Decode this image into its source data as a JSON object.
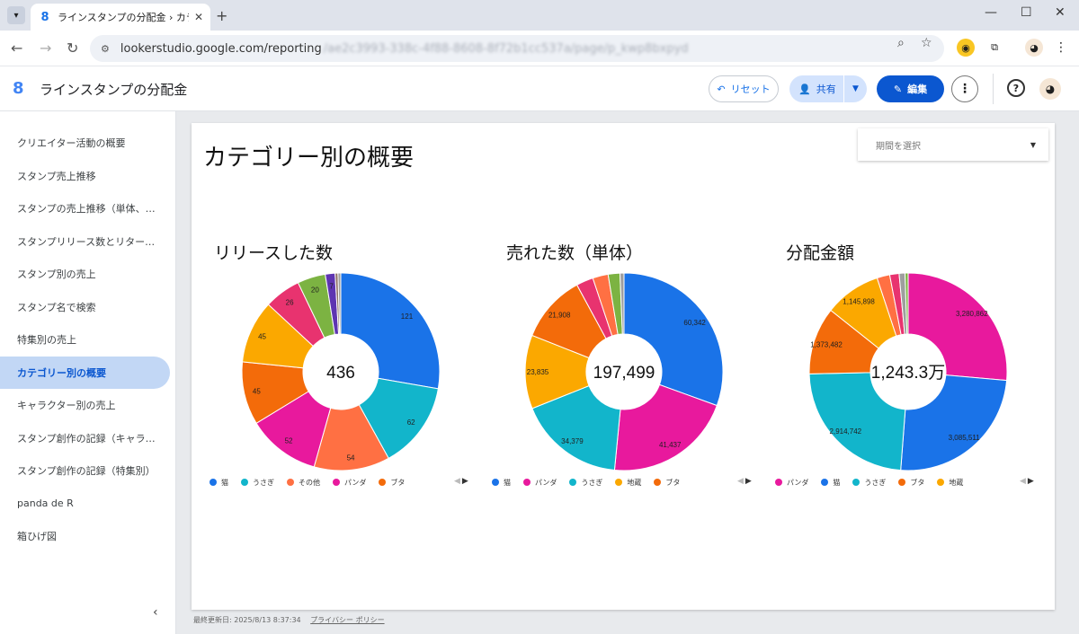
{
  "browser": {
    "tab_title": "ラインスタンプの分配金 › カテゴリー別",
    "url": "lookerstudio.google.com/reporting",
    "url_hidden": "/ae2c3993-338c-4f88-8608-8f72b1cc537a/page/p_kwp8bxpyd"
  },
  "app": {
    "title": "ラインスタンプの分配金",
    "reset_label": "リセット",
    "share_label": "共有",
    "edit_label": "編集"
  },
  "sidebar": {
    "items": [
      {
        "label": "クリエイター活動の概要"
      },
      {
        "label": "スタンプ売上推移"
      },
      {
        "label": "スタンプの売上推移（単体、…"
      },
      {
        "label": "スタンプリリース数とリター…"
      },
      {
        "label": "スタンプ別の売上"
      },
      {
        "label": "スタンプ名で検索"
      },
      {
        "label": "特集別の売上"
      },
      {
        "label": "カテゴリー別の概要",
        "active": true
      },
      {
        "label": "キャラクター別の売上"
      },
      {
        "label": "スタンプ創作の記録（キャラ…"
      },
      {
        "label": "スタンプ創作の記録（特集別）"
      },
      {
        "label": "panda de R"
      },
      {
        "label": "箱ひげ図"
      }
    ]
  },
  "page": {
    "title": "カテゴリー別の概要",
    "date_placeholder": "期間を選択",
    "footer_updated": "最終更新日: 2025/8/13 8:37:34",
    "footer_privacy": "プライバシー ポリシー"
  },
  "chart_data": [
    {
      "type": "pie",
      "title": "リリースした数",
      "center_label": "436",
      "slices": [
        {
          "label": "猫",
          "value": 121,
          "color": "#1a73e8",
          "show": true
        },
        {
          "label": "うさぎ",
          "value": 62,
          "color": "#12b5cb",
          "show": true
        },
        {
          "label": "その他",
          "value": 54,
          "color": "#ff7043",
          "show": true
        },
        {
          "label": "パンダ",
          "value": 52,
          "color": "#e8199d",
          "show": true
        },
        {
          "label": "ブタ",
          "value": 45,
          "color": "#f36b0a",
          "show": true
        },
        {
          "label": "",
          "value": 45,
          "color": "#fba800",
          "show": true
        },
        {
          "label": "",
          "value": 26,
          "color": "#e8336f",
          "show": true
        },
        {
          "label": "",
          "value": 20,
          "color": "#7cb342",
          "show": true
        },
        {
          "label": "",
          "value": 7,
          "color": "#5e35b1",
          "show": true
        },
        {
          "label": "",
          "value": 2,
          "color": "#8d6e63",
          "show": false
        },
        {
          "label": "",
          "value": 2,
          "color": "#9e9e9e",
          "show": false
        }
      ],
      "legend": [
        "猫",
        "うさぎ",
        "その他",
        "パンダ",
        "ブタ"
      ]
    },
    {
      "type": "pie",
      "title": "売れた数（単体）",
      "center_label": "197,499",
      "slices": [
        {
          "label": "猫",
          "value": 60342,
          "color": "#1a73e8",
          "show": true
        },
        {
          "label": "パンダ",
          "value": 41437,
          "color": "#e8199d",
          "show": true
        },
        {
          "label": "うさぎ",
          "value": 34379,
          "color": "#12b5cb",
          "show": true
        },
        {
          "label": "地蔵",
          "value": 23835,
          "color": "#fba800",
          "show": true
        },
        {
          "label": "ブタ",
          "value": 21908,
          "color": "#f36b0a",
          "show": true
        },
        {
          "label": "",
          "value": 5500,
          "color": "#e8336f",
          "show": false
        },
        {
          "label": "",
          "value": 5000,
          "color": "#ff7043",
          "show": false
        },
        {
          "label": "",
          "value": 3800,
          "color": "#7cb342",
          "show": false
        },
        {
          "label": "",
          "value": 1298,
          "color": "#9e9e9e",
          "show": false
        }
      ],
      "legend": [
        "猫",
        "パンダ",
        "うさぎ",
        "地蔵",
        "ブタ"
      ]
    },
    {
      "type": "pie",
      "title": "分配金額",
      "center_label": "1,243.3万",
      "slices": [
        {
          "label": "パンダ",
          "value": 3280862,
          "color": "#e8199d",
          "show": true
        },
        {
          "label": "猫",
          "value": 3085511,
          "color": "#1a73e8",
          "show": true
        },
        {
          "label": "うさぎ",
          "value": 2914742,
          "color": "#12b5cb",
          "show": true
        },
        {
          "label": "ブタ",
          "value": 1373482,
          "color": "#f36b0a",
          "show": true
        },
        {
          "label": "地蔵",
          "value": 1145898,
          "color": "#fba800",
          "show": true
        },
        {
          "label": "",
          "value": 260000,
          "color": "#ff7043",
          "show": false
        },
        {
          "label": "",
          "value": 190000,
          "color": "#e8336f",
          "show": false
        },
        {
          "label": "",
          "value": 120000,
          "color": "#9e9e9e",
          "show": false
        },
        {
          "label": "",
          "value": 62505,
          "color": "#7cb342",
          "show": false
        }
      ],
      "legend": [
        "パンダ",
        "猫",
        "うさぎ",
        "ブタ",
        "地蔵"
      ]
    }
  ]
}
